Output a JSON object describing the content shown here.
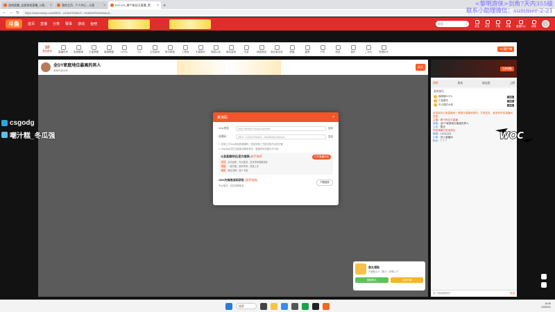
{
  "browser": {
    "tabs": [
      {
        "title": "游戏直播_全部游戏直播_斗鱼直播",
        "active": false
      },
      {
        "title": "我的主页 - 个人中心 - 斗鱼",
        "active": false
      },
      {
        "title": "DYL123_哪个粉丝又直播_黑哥叫…",
        "active": true
      }
    ],
    "new_tab": "+",
    "url": "https://www.douyu.com/6810…c43ed7b9a2c3…bea05d29c49efa4c&…",
    "nav": {
      "back": "←",
      "forward": "→",
      "reload": "↻"
    }
  },
  "overlay_text": {
    "line1": "<黎明游侠>剑角7天内355级",
    "line2": "联系小助理微信：summer-2-21"
  },
  "site": {
    "logo": "斗鱼",
    "nav": [
      "首页",
      "直播",
      "分类",
      "赛事",
      "游戏",
      "鱼吧"
    ],
    "search_placeholder": "搜索",
    "header_icons": [
      "关注",
      "历史",
      "下载",
      "开播",
      "直播中心",
      "消息"
    ]
  },
  "category_bar": {
    "coin_count": "10",
    "coin_label": "签到得币",
    "items": [
      "直播任务",
      "电竞赛事",
      "王者荣耀",
      "英雄联盟",
      "DOTA",
      "CS",
      "主机游戏",
      "和平精英",
      "三角洲",
      "无畏契约",
      "穿越火线",
      "单机游戏",
      "手游",
      "网游竞技",
      "鱼乐星天地",
      "颜值",
      "星秀",
      "户外",
      "科技",
      "音乐",
      "二次元",
      "吃喝玩乐"
    ],
    "pc_button": "PC客户端"
  },
  "stream": {
    "title": "全DY家庭地位最高的男人",
    "meta": "黑哥叫我去死",
    "follow_label": "关注"
  },
  "modal": {
    "title": "推流码",
    "close": "×",
    "rtmp_label": "rtmp地址",
    "rtmp_value": "rtmp://sendtc3.douyu.com/live",
    "stream_label": "直播码",
    "stream_value": "6810…c43ed7b9a2c3…bea05d29c49efa4c",
    "copy_label": "复制",
    "notes": [
      "1. 复制上方rtmp地址和直播码，粘贴到第三方推流软件对应位置",
      "2. rtmp地址仅在当前推流期间有效，直播码有效期为30分钟"
    ],
    "promo_title": "斗鱼直播伴侣(官方推荐)",
    "promo_subtitle": "新手推荐",
    "promo_lines": [
      {
        "tag": "专业",
        "text": "高清画质，专业推流，支持多种直播场景"
      },
      {
        "tag": "快速",
        "text": "一键开播，操作简单，快速上手"
      },
      {
        "tag": "稳定",
        "text": "稳定流畅，减少卡顿"
      }
    ],
    "promo_button": "打开直播伴侣",
    "obs_title": "OBS先锋推流码获取",
    "obs_subtitle": "(推荐指南)",
    "obs_desc": "专业推流，支持流畅推流",
    "obs_button": "下载插件"
  },
  "captions": [
    {
      "text": "csgodg",
      "icon_color": "#2ba7e0"
    },
    {
      "text": "嘲汁糕_冬瓜强",
      "icon_color": "#5ec2e8"
    }
  ],
  "sidebar": {
    "ad_button": "立即领取",
    "tabs": [
      "周榜",
      "贵宾",
      "粉丝团",
      "上榜"
    ],
    "rank_title": "贵宾排行",
    "ranks": [
      {
        "name": "嘟嘟嘟DOTA",
        "level": "贵族"
      },
      {
        "name": "小鱼爱吃",
        "level": "贵族"
      },
      {
        "name": "冬瓜强的大粉",
        "level": "贵族"
      }
    ],
    "chat": [
      {
        "type": "notice",
        "text": "欢迎来到斗鱼直播间！请遵守直播间规则，文明发言，营造良好的直播间氛围。"
      },
      {
        "type": "sys",
        "text": "主播：哪个粉丝又直播"
      },
      {
        "type": "msg",
        "user": "房管：",
        "text": "全DY家庭地位最高的男人"
      },
      {
        "type": "msg",
        "user": "公告：",
        "text": "暂无"
      },
      {
        "type": "sys",
        "text": "你的弹幕已发送成功"
      },
      {
        "type": "msg",
        "user": "嘟嘟：",
        "text": "111111111"
      },
      {
        "type": "msg",
        "user": "小鱼：",
        "text": "进入直播间"
      },
      {
        "type": "msg",
        "user": "粉丝：",
        "text": "？？？"
      }
    ],
    "input_placeholder": "发个弹幕聊聊吧~",
    "input_send": "发送"
  },
  "gift_popup": {
    "name": "鱼丸领取",
    "desc": "开通鱼丸卡（累计）获得以下",
    "btn_left": "领取鱼丸",
    "btn_right": "立即开通"
  },
  "woc_logo": "WOC",
  "taskbar": {
    "search": "搜索",
    "time": "16:06",
    "date": "2025/3/1"
  }
}
